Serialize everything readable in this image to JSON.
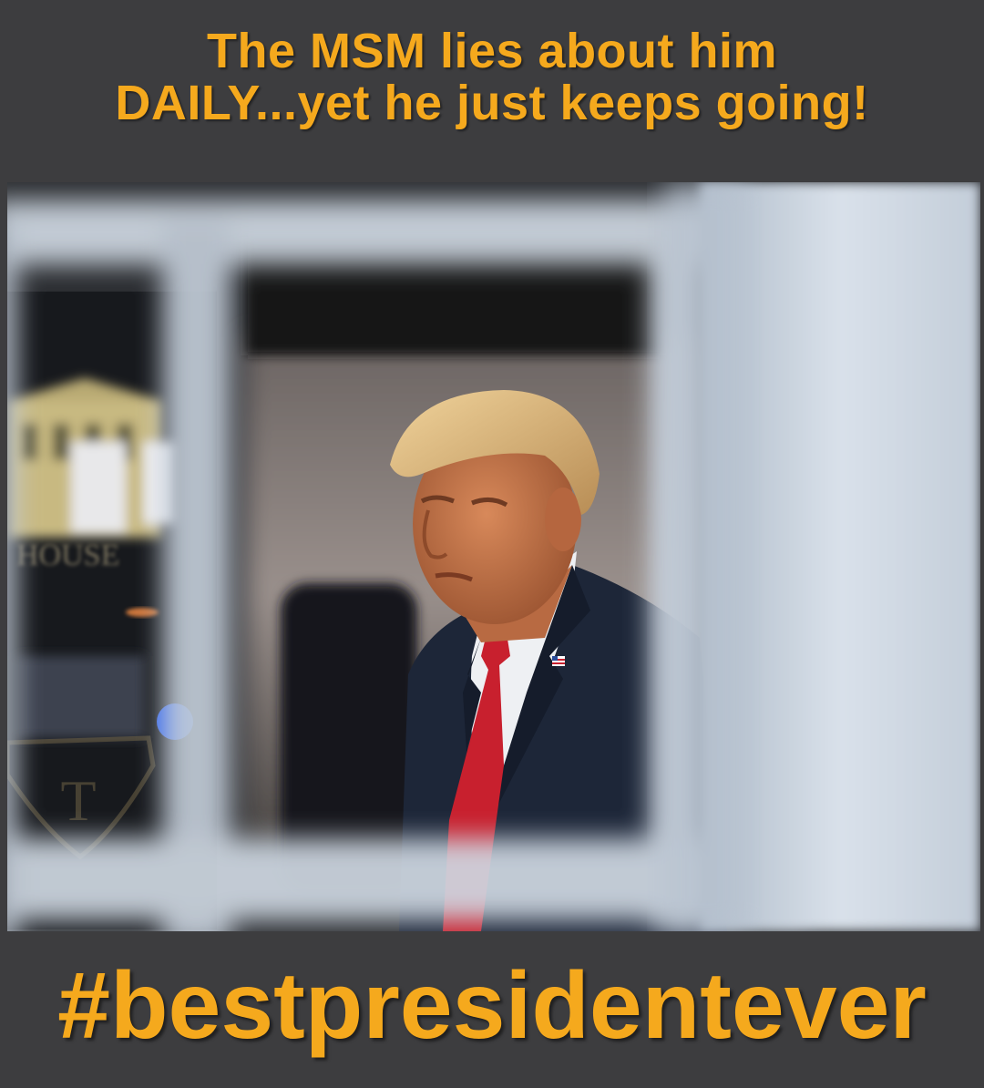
{
  "caption": {
    "line1": "The MSM lies about him",
    "line2": "DAILY...yet he just keeps going!"
  },
  "photo": {
    "building_text": "HOUSE",
    "watermark_letter": "T"
  },
  "hashtag": "#bestpresidentever",
  "colors": {
    "background": "#3d3d3f",
    "caption_text": "#f5a91d",
    "tie": "#c8202e",
    "suit": "#1d2638",
    "window_frame": "#c9d3de"
  }
}
